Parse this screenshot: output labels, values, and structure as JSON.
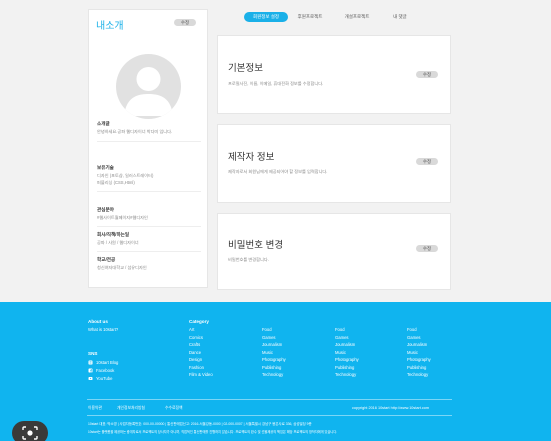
{
  "profile": {
    "title": "내소개",
    "edit_label": "수정",
    "sections": [
      {
        "heading": "소개글",
        "lines": [
          "안녕하세요.공파 웹디자이너 박다미 입니다."
        ]
      },
      {
        "heading": "보유기술",
        "lines": [
          "디자인 (포토샵, 일러스트레이터)",
          "퍼블리싱 (CSS,Html)"
        ]
      },
      {
        "heading": "관심분야",
        "lines": [
          "#웹사이트월페이지#웹디자인"
        ]
      },
      {
        "heading": "회사/직책/하는일",
        "lines": [
          "공파 / 사원 / 웹디자이너"
        ]
      },
      {
        "heading": "학교/전공",
        "lines": [
          "청신여자대학교 / 섬유디자인"
        ]
      }
    ]
  },
  "tabs": [
    {
      "label": "회원정보 설정",
      "active": true
    },
    {
      "label": "후원프로젝트",
      "active": false
    },
    {
      "label": "개설프로젝트",
      "active": false
    },
    {
      "label": "내 댓글",
      "active": false
    }
  ],
  "cards": [
    {
      "title": "기본정보",
      "desc": "프로필사진, 이름, 이메일, 휴대전화 정보를 수정합니다.",
      "edit_label": "수정"
    },
    {
      "title": "제작자 정보",
      "desc": "제작자로서 회원님에게 제공되어야 할 정보를 입력합니다.",
      "edit_label": "수정"
    },
    {
      "title": "비밀번호 변경",
      "desc": "비밀번호를 변경합니다.",
      "edit_label": "수정"
    }
  ],
  "footer": {
    "about": {
      "heading": "About us",
      "links": [
        "What is 10start?"
      ]
    },
    "sns": {
      "heading": "SNS",
      "links": [
        {
          "label": "10start Blog",
          "icon": "blog-icon"
        },
        {
          "label": "Facebook",
          "icon": "facebook-icon"
        },
        {
          "label": "YouTube",
          "icon": "youtube-icon"
        }
      ]
    },
    "category": {
      "heading": "Category",
      "columns": [
        [
          "Art",
          "Comics",
          "Crafts",
          "Dance",
          "Design",
          "Fashion",
          "Film & Video"
        ],
        [
          "Food",
          "Games",
          "Journalism",
          "Music",
          "Photography",
          "Publishing",
          "Technology"
        ],
        [
          "Food",
          "Games",
          "Journalism",
          "Music",
          "Photography",
          "Publishing",
          "Technology"
        ],
        [
          "Food",
          "Games",
          "Journalism",
          "Music",
          "Photography",
          "Publishing",
          "Technology"
        ]
      ]
    },
    "bottom_links": [
      "이용약관",
      "개인정보처리방침",
      "수수료정책"
    ],
    "copyright": "copyright 2016 10start http://www.10start.com",
    "company": "10start  대표: 박소영  |  사업자등록번호: 000-00-00000  |  통신판매업신고: 2016-서울강동-0000  |  02-000-0007  |  서울특별시 강남구 봉은사로 336, 삼성빌딩 9층",
    "notice": "10start는 플랫폼을 제공하는 중개자로서 프로젝트의 당사자가 아니며, 직접적인 통신판매를 진행하지 않습니다. 프로젝트의 완수 및 선물제공의 책임은 해당 프로젝트의 창작자에게 있습니다."
  },
  "lens_icon": "lens-icon"
}
